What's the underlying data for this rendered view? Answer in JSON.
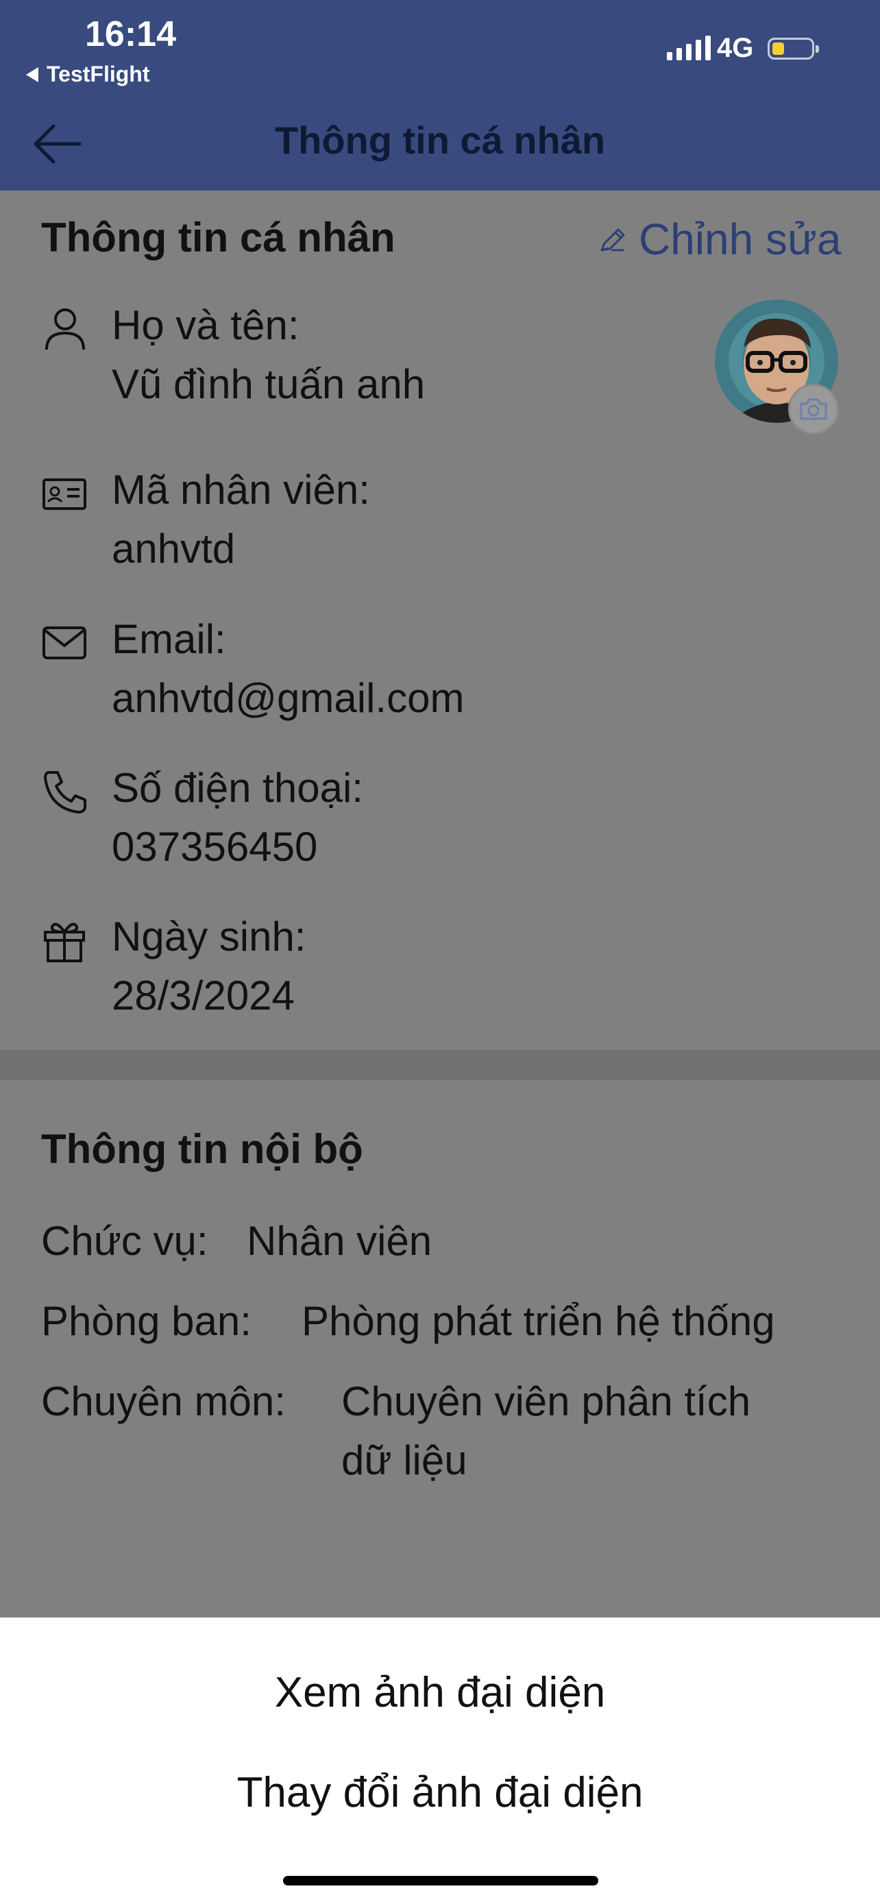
{
  "status_bar": {
    "time": "16:14",
    "back_app": "TestFlight",
    "network": "4G"
  },
  "nav": {
    "title": "Thông tin cá nhân"
  },
  "personal": {
    "title": "Thông tin cá nhân",
    "edit_label": "Chỉnh sửa",
    "fields": [
      {
        "icon": "person-icon",
        "label": "Họ và tên:",
        "value": "Vũ đình tuấn anh"
      },
      {
        "icon": "id-card-icon",
        "label": "Mã nhân viên:",
        "value": "anhvtd"
      },
      {
        "icon": "mail-icon",
        "label": "Email:",
        "value": "anhvtd@gmail.com"
      },
      {
        "icon": "phone-icon",
        "label": "Số điện thoại:",
        "value": "037356450"
      },
      {
        "icon": "gift-icon",
        "label": "Ngày sinh:",
        "value": "28/3/2024"
      }
    ]
  },
  "internal": {
    "title": "Thông tin nội bộ",
    "rows": [
      {
        "label": "Chức vụ:",
        "value": "Nhân viên"
      },
      {
        "label": "Phòng ban:",
        "value": "Phòng phát triển hệ thống"
      },
      {
        "label": "Chuyên môn:",
        "value": "Chuyên viên phân tích",
        "value_line2": "dữ liệu"
      }
    ]
  },
  "sheet": {
    "options": [
      "Xem ảnh đại diện",
      "Thay đổi ảnh đại diện"
    ]
  },
  "colors": {
    "header_bg": "#384a7e",
    "overlay_bg": "#808080",
    "accent": "#2c3f75",
    "battery": "#f5d132"
  }
}
